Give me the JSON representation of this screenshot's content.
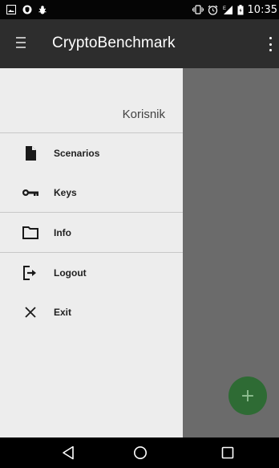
{
  "status_bar": {
    "time": "10:35",
    "left_icons": [
      "image-icon",
      "shield-icon",
      "bug-icon"
    ],
    "right_icons": [
      "vibrate-icon",
      "alarm-icon",
      "signal-icon",
      "battery-icon"
    ]
  },
  "toolbar": {
    "title": "CryptoBenchmark",
    "menu_icon": "hamburger-icon",
    "overflow_icon": "more-vert-icon"
  },
  "drawer": {
    "user_name": "Korisnik",
    "items": [
      {
        "label": "Scenarios",
        "icon": "file-icon"
      },
      {
        "label": "Keys",
        "icon": "key-icon"
      },
      {
        "label": "Info",
        "icon": "folder-icon"
      },
      {
        "label": "Logout",
        "icon": "logout-icon"
      },
      {
        "label": "Exit",
        "icon": "close-icon"
      }
    ]
  },
  "fab": {
    "label": "+",
    "color": "#2e6b34"
  },
  "colors": {
    "toolbar": "#2d2d2d",
    "drawer": "#ededed",
    "scrim": "#6b6b6b",
    "status_bar": "#050505"
  },
  "nav_bar": {
    "buttons": [
      "back-icon",
      "home-icon",
      "recents-icon"
    ]
  }
}
